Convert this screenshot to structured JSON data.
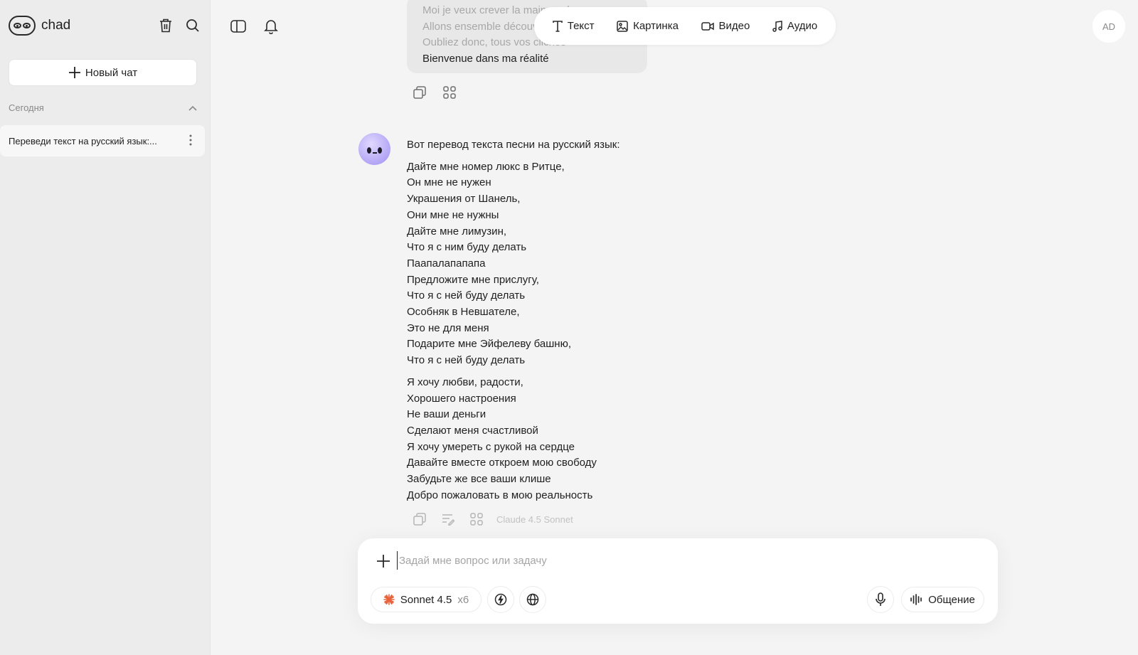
{
  "app": {
    "name": "chad"
  },
  "sidebar": {
    "new_chat_label": "Новый чат",
    "section_label": "Сегодня",
    "chats": [
      {
        "title": "Переведи текст на русский язык:..."
      }
    ]
  },
  "modes": [
    {
      "label": "Текст",
      "icon": "text-icon"
    },
    {
      "label": "Картинка",
      "icon": "image-icon"
    },
    {
      "label": "Видео",
      "icon": "video-icon"
    },
    {
      "label": "Аудио",
      "icon": "audio-icon"
    }
  ],
  "user": {
    "initials": "AD"
  },
  "conversation": {
    "user_message_lines": [
      "Moi je veux crever la main sur le cœur",
      "Allons ensemble découvrir ma liberté",
      "Oubliez donc, tous vos clichés",
      "Bienvenue dans ma réalité"
    ],
    "assistant": {
      "intro": "Вот перевод текста песни на русский язык:",
      "stanza1": [
        "Дайте мне номер люкс в Ритце,",
        "Он мне не нужен",
        "Украшения от Шанель,",
        "Они мне не нужны",
        "Дайте мне лимузин,",
        "Что я с ним буду делать",
        "Паапалапапапа",
        "Предложите мне прислугу,",
        "Что я с ней буду делать",
        "Особняк в Невшателе,",
        "Это не для меня",
        "Подарите мне Эйфелеву башню,",
        "Что я с ней буду делать"
      ],
      "stanza2": [
        "Я хочу любви, радости,",
        "Хорошего настроения",
        "Не ваши деньги",
        "Сделают меня счастливой",
        "Я хочу умереть с рукой на сердце",
        "Давайте вместе откроем мою свободу",
        "Забудьте же все ваши клише",
        "Добро пожаловать в мою реальность"
      ],
      "model_label": "Claude 4.5 Sonnet"
    }
  },
  "composer": {
    "placeholder": "Задай мне вопрос или задачу",
    "model_name": "Sonnet 4.5",
    "model_multiplier": "x6",
    "talk_label": "Общение"
  },
  "colors": {
    "accent_model": "#e8623c",
    "bot_avatar": "#b3a5f5"
  }
}
